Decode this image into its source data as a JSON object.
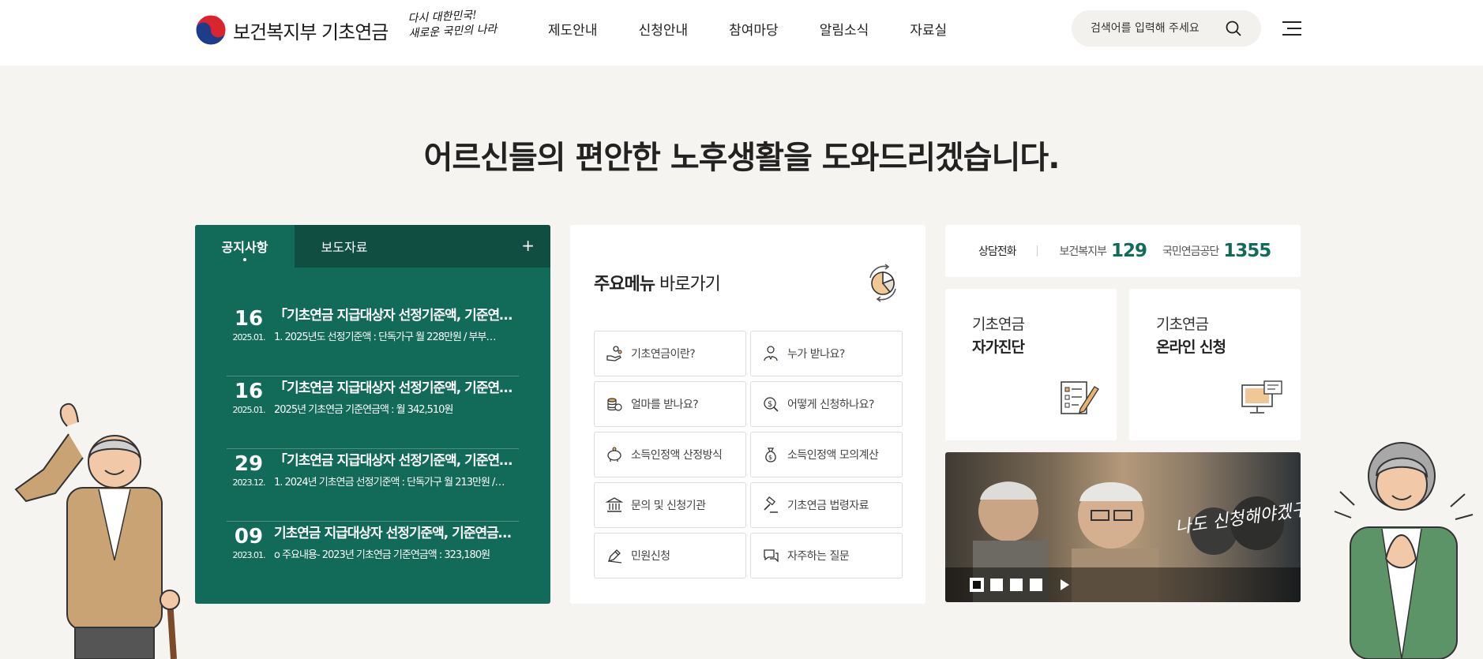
{
  "header": {
    "logo_text": "보건복지부 기초연금",
    "slogan_line1": "다시 대한민국!",
    "slogan_line2": "새로운 국민의 나라",
    "nav": [
      "제도안내",
      "신청안내",
      "참여마당",
      "알림소식",
      "자료실"
    ],
    "search_placeholder": "검색어를 입력해 주세요"
  },
  "hero": {
    "pre": "어르신들의 ",
    "bold": "편안한 노후생활",
    "post": "을 도와드리겠습니다."
  },
  "notice": {
    "tab_active": "공지사항",
    "tab_other": "보도자료",
    "more": "+",
    "items": [
      {
        "day": "16",
        "ym": "2025.01.",
        "title": "「기초연금 지급대상자 선정기준액, 기준연금액, …",
        "desc": "1. 2025년도 선정기준액 : 단독가구 월 228만원 / 부부…"
      },
      {
        "day": "16",
        "ym": "2025.01.",
        "title": "「기초연금 지급대상자 선정기준액, 기준연금액, …",
        "desc": "2025년 기초연금 기준연금액 : 월 342,510원"
      },
      {
        "day": "29",
        "ym": "2023.12.",
        "title": "「기초연금 지급대상자 선정기준액, 기준연금액, …",
        "desc": "1. 2024년 기초연금 선정기준액 : 단독가구 월 213만원 /…"
      },
      {
        "day": "09",
        "ym": "2023.01.",
        "title": "기초연금 지급대상자 선정기준액, 기준연금액, …",
        "desc": "o 주요내용- 2023년 기초연금 기준연금액 : 323,180원"
      }
    ]
  },
  "quick": {
    "title_bold": "주요메뉴",
    "title_rest": " 바로가기",
    "items": [
      {
        "label": "기초연금이란?",
        "icon": "coins-hand-icon"
      },
      {
        "label": "누가 받나요?",
        "icon": "person-icon"
      },
      {
        "label": "얼마를 받나요?",
        "icon": "coin-stack-icon"
      },
      {
        "label": "어떻게 신청하나요?",
        "icon": "money-search-icon"
      },
      {
        "label": "소득인정액 산정방식",
        "icon": "piggy-bank-icon"
      },
      {
        "label": "소득인정액 모의계산",
        "icon": "money-bag-icon"
      },
      {
        "label": "문의 및 신청기관",
        "icon": "bank-building-icon"
      },
      {
        "label": "기초연금 법령자료",
        "icon": "gavel-icon"
      },
      {
        "label": "민원신청",
        "icon": "pen-icon"
      },
      {
        "label": "자주하는 질문",
        "icon": "chat-bubble-icon"
      }
    ]
  },
  "call": {
    "label": "상담전화",
    "org1": "보건복지부",
    "num1": "129",
    "org2": "국민연금공단",
    "num2": "1355"
  },
  "cards": [
    {
      "line1": "기초연금",
      "line2": "자가진단",
      "icon": "checklist-pen-icon"
    },
    {
      "line1": "기초연금",
      "line2": "온라인 신청",
      "icon": "computer-monitor-icon"
    }
  ],
  "banner": {
    "caption": "나도 신청해야겠구먼!",
    "slides": 4
  },
  "colors": {
    "primary_green": "#126a58",
    "dark_green": "#0f4e41",
    "background": "#f6f4f1"
  }
}
